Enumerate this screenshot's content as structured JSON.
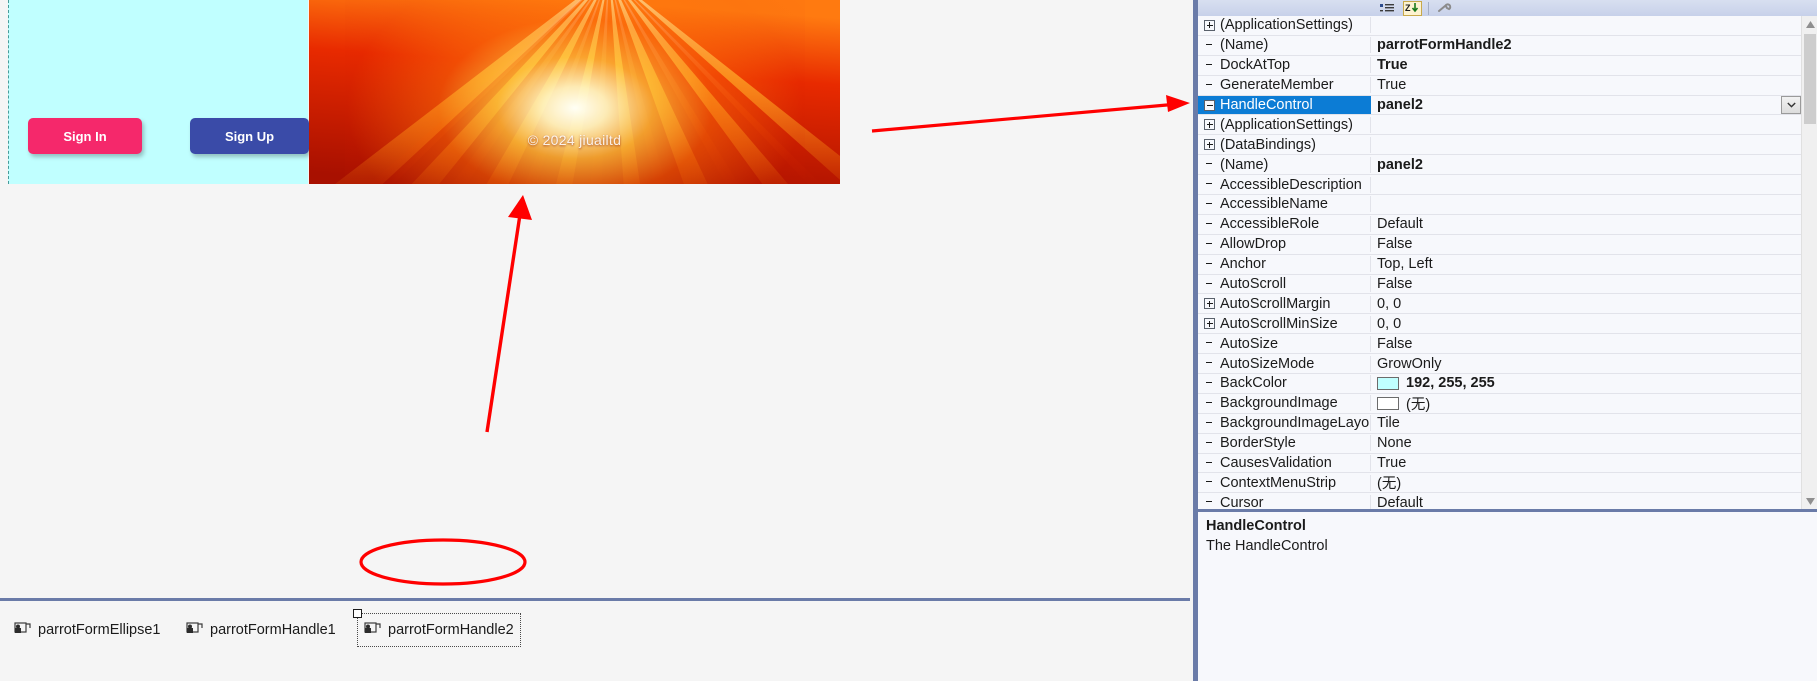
{
  "designer": {
    "form": {
      "panel": {
        "name": "panel2",
        "back_color": "#c0ffff",
        "buttons": [
          {
            "label": "Sign In",
            "color": "#f5286b",
            "name": "sign-in-button"
          },
          {
            "label": "Sign Up",
            "color": "#3a4ba8",
            "name": "sign-up-button"
          }
        ]
      },
      "banner": {
        "watermark": "© 2024 jiuailtd",
        "base_color": "#c81200",
        "ray_color": "#ffd24a"
      }
    }
  },
  "component_tray": {
    "items": [
      {
        "label": "parrotFormEllipse1",
        "selected": false
      },
      {
        "label": "parrotFormHandle1",
        "selected": false
      },
      {
        "label": "parrotFormHandle2",
        "selected": true
      }
    ]
  },
  "property_panel": {
    "toolbar": {
      "buttons": [
        {
          "name": "categorized-button",
          "active": false
        },
        {
          "name": "alphabetical-button",
          "active": true
        },
        {
          "name": "properties-button",
          "active": false
        }
      ]
    },
    "rows": [
      {
        "name": "(ApplicationSettings)",
        "value": "",
        "expander": "plus",
        "indent": 0,
        "bold": false,
        "selected": false
      },
      {
        "name": "(Name)",
        "value": "parrotFormHandle2",
        "expander": "none",
        "indent": 0,
        "bold": true,
        "selected": false
      },
      {
        "name": "DockAtTop",
        "value": "True",
        "expander": "none",
        "indent": 0,
        "bold": true,
        "selected": false
      },
      {
        "name": "GenerateMember",
        "value": "True",
        "expander": "none",
        "indent": 0,
        "bold": false,
        "selected": false
      },
      {
        "name": "HandleControl",
        "value": "panel2",
        "expander": "minus",
        "indent": 0,
        "bold": true,
        "selected": true,
        "dropdown": true
      },
      {
        "name": "(ApplicationSettings)",
        "value": "",
        "expander": "plus",
        "indent": 1,
        "bold": false,
        "selected": false
      },
      {
        "name": "(DataBindings)",
        "value": "",
        "expander": "plus",
        "indent": 1,
        "bold": false,
        "selected": false
      },
      {
        "name": "(Name)",
        "value": "panel2",
        "expander": "none",
        "indent": 1,
        "bold": true,
        "selected": false
      },
      {
        "name": "AccessibleDescription",
        "value": "",
        "expander": "none",
        "indent": 1,
        "bold": false,
        "selected": false
      },
      {
        "name": "AccessibleName",
        "value": "",
        "expander": "none",
        "indent": 1,
        "bold": false,
        "selected": false
      },
      {
        "name": "AccessibleRole",
        "value": "Default",
        "expander": "none",
        "indent": 1,
        "bold": false,
        "selected": false
      },
      {
        "name": "AllowDrop",
        "value": "False",
        "expander": "none",
        "indent": 1,
        "bold": false,
        "selected": false
      },
      {
        "name": "Anchor",
        "value": "Top, Left",
        "expander": "none",
        "indent": 1,
        "bold": false,
        "selected": false
      },
      {
        "name": "AutoScroll",
        "value": "False",
        "expander": "none",
        "indent": 1,
        "bold": false,
        "selected": false
      },
      {
        "name": "AutoScrollMargin",
        "value": "0, 0",
        "expander": "plus",
        "indent": 1,
        "bold": false,
        "selected": false
      },
      {
        "name": "AutoScrollMinSize",
        "value": "0, 0",
        "expander": "plus",
        "indent": 1,
        "bold": false,
        "selected": false
      },
      {
        "name": "AutoSize",
        "value": "False",
        "expander": "none",
        "indent": 1,
        "bold": false,
        "selected": false
      },
      {
        "name": "AutoSizeMode",
        "value": "GrowOnly",
        "expander": "none",
        "indent": 1,
        "bold": false,
        "selected": false
      },
      {
        "name": "BackColor",
        "value": "192, 255, 255",
        "expander": "none",
        "indent": 1,
        "bold": true,
        "selected": false,
        "swatch": "#c0ffff"
      },
      {
        "name": "BackgroundImage",
        "value": "(无)",
        "expander": "none",
        "indent": 1,
        "bold": false,
        "selected": false,
        "swatch": "#ffffff"
      },
      {
        "name": "BackgroundImageLayo",
        "value": "Tile",
        "expander": "none",
        "indent": 1,
        "bold": false,
        "selected": false
      },
      {
        "name": "BorderStyle",
        "value": "None",
        "expander": "none",
        "indent": 1,
        "bold": false,
        "selected": false
      },
      {
        "name": "CausesValidation",
        "value": "True",
        "expander": "none",
        "indent": 1,
        "bold": false,
        "selected": false
      },
      {
        "name": "ContextMenuStrip",
        "value": "(无)",
        "expander": "none",
        "indent": 1,
        "bold": false,
        "selected": false
      },
      {
        "name": "Cursor",
        "value": "Default",
        "expander": "none",
        "indent": 1,
        "bold": false,
        "selected": false
      }
    ],
    "description": {
      "title": "HandleControl",
      "text": "The HandleControl"
    }
  },
  "annotations": {
    "accent_color": "#ff0000",
    "arrow_to_property": "arrow-pointing-to-handlecontrol-row",
    "arrow_to_tray": "arrow-pointing-to-component-tray",
    "ellipse_highlight": "ellipse-around-parrotformhandle2"
  }
}
